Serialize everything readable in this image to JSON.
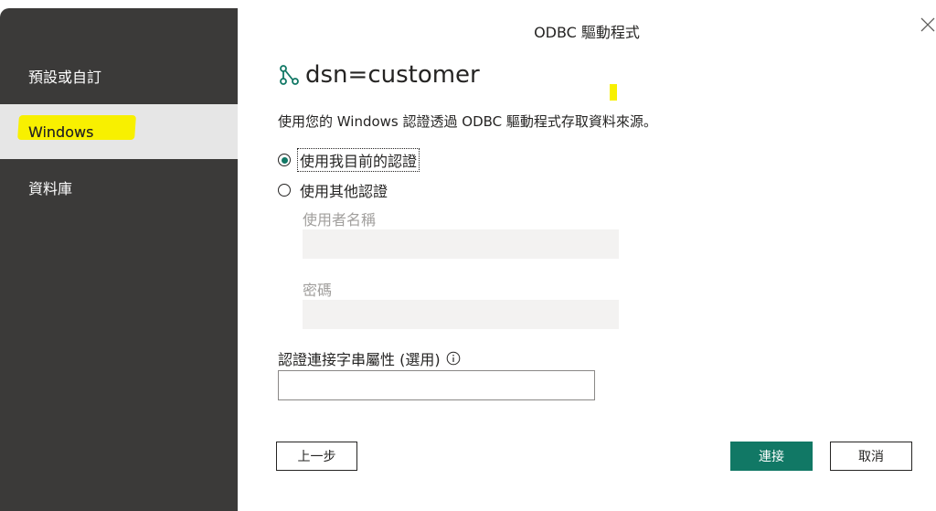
{
  "window": {
    "title": "ODBC 驅動程式"
  },
  "sidebar": {
    "items": [
      {
        "label": "預設或自訂",
        "active": false
      },
      {
        "label": "Windows",
        "active": true
      },
      {
        "label": "資料庫",
        "active": false
      }
    ]
  },
  "header": {
    "title": "dsn=customer",
    "icon": "branch-icon"
  },
  "description": "使用您的 Windows 認證透過 ODBC 驅動程式存取資料來源。",
  "auth": {
    "options": [
      {
        "label": "使用我目前的認證",
        "selected": true
      },
      {
        "label": "使用其他認證",
        "selected": false
      }
    ],
    "username_label": "使用者名稱",
    "username_value": "",
    "password_label": "密碼",
    "password_value": ""
  },
  "connection_string": {
    "label": "認證連接字串屬性 (選用)",
    "value": ""
  },
  "buttons": {
    "back": "上一步",
    "connect": "連接",
    "cancel": "取消"
  },
  "colors": {
    "accent": "#117865",
    "sidebar": "#3b3a39",
    "highlight": "#f8f000"
  }
}
